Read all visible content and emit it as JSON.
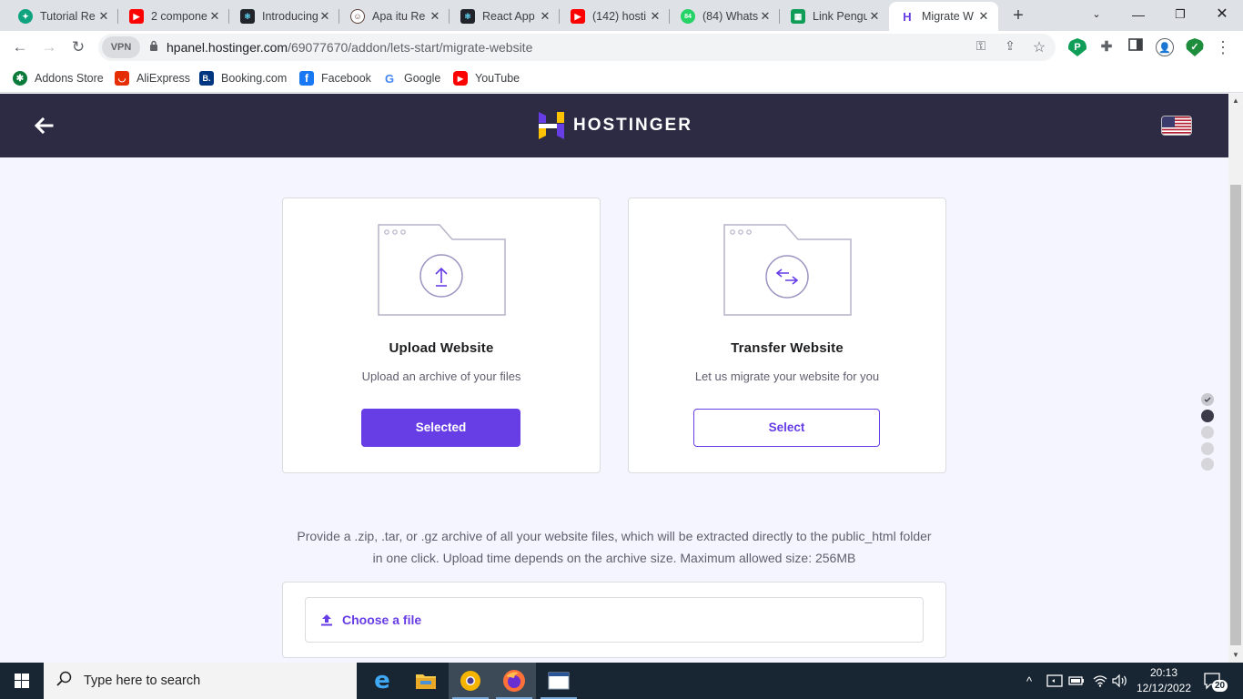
{
  "browser": {
    "tabs": [
      {
        "title": "Tutorial Re",
        "icon": "chatgpt-icon",
        "color": "#10a37f"
      },
      {
        "title": "2 compone",
        "icon": "youtube-icon",
        "color": "#ff0000"
      },
      {
        "title": "Introducing",
        "icon": "react-icon",
        "color": "#20232a"
      },
      {
        "title": "Apa itu Re",
        "icon": "face-icon",
        "color": "#8d6e63"
      },
      {
        "title": "React App",
        "icon": "react-icon",
        "color": "#20232a"
      },
      {
        "title": "(142) hosti",
        "icon": "youtube-icon",
        "color": "#ff0000"
      },
      {
        "title": "(84) Whats",
        "icon": "whatsapp-icon",
        "color": "#25d366",
        "badge": "84"
      },
      {
        "title": "Link Pengu",
        "icon": "sheets-icon",
        "color": "#0f9d58"
      },
      {
        "title": "Migrate W",
        "icon": "hostinger-icon",
        "color": "#673de6"
      }
    ],
    "url_host": "hpanel.hostinger.com",
    "url_path": "/69077670/addon/lets-start/migrate-website",
    "vpn_label": "VPN",
    "bookmarks": [
      {
        "label": "Addons Store",
        "color": "#0a7a3a",
        "glyph": "✱"
      },
      {
        "label": "AliExpress",
        "color": "#e62e04",
        "glyph": "◡"
      },
      {
        "label": "Booking.com",
        "color": "#003580",
        "glyph": "B."
      },
      {
        "label": "Facebook",
        "color": "#1877f2",
        "glyph": "f"
      },
      {
        "label": "Google",
        "color": "#ffffff",
        "glyph": "G"
      },
      {
        "label": "YouTube",
        "color": "#ff0000",
        "glyph": "▶"
      }
    ]
  },
  "header": {
    "brand": "HOSTINGER"
  },
  "options": [
    {
      "title": "Upload Website",
      "description": "Upload an archive of your files",
      "button": "Selected"
    },
    {
      "title": "Transfer Website",
      "description": "Let us migrate your website for you",
      "button": "Select"
    }
  ],
  "info_line1": "Provide a .zip, .tar, or .gz archive of all your website files, which will be extracted directly to the public_html folder",
  "info_line2": "in one click. Upload time depends on the archive size. Maximum allowed size: 256MB",
  "upload": {
    "label": "Choose a file"
  },
  "steps": {
    "total": 5,
    "completed": 1,
    "current": 2
  },
  "taskbar": {
    "search_placeholder": "Type here to search",
    "time": "20:13",
    "date": "12/12/2022",
    "notifications": "20"
  },
  "colors": {
    "accent": "#673de6",
    "header_bg": "#2d2a44",
    "page_bg": "#f4f5ff"
  }
}
